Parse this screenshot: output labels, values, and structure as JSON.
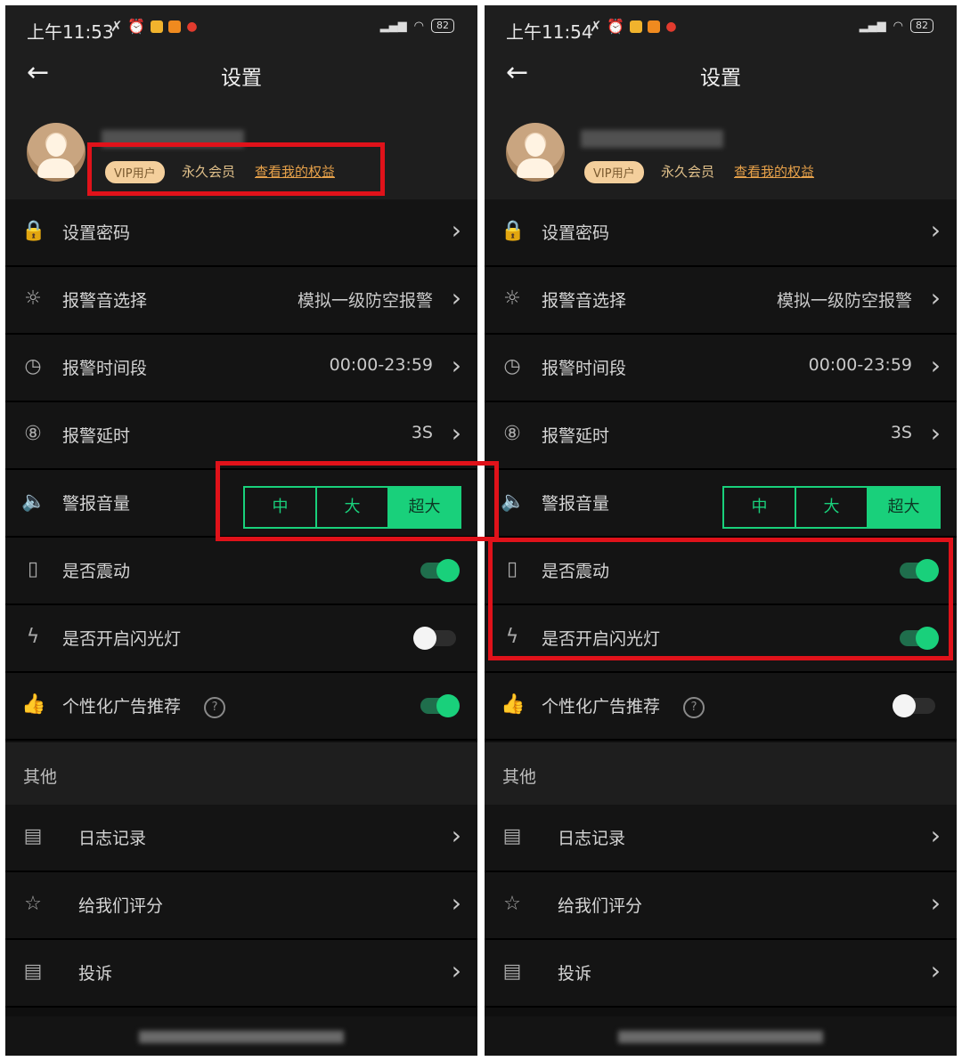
{
  "screens": [
    {
      "status": {
        "time": "上午11:53",
        "battery": "82"
      },
      "header": {
        "back_icon": "arrow-left-icon",
        "title": "设置"
      },
      "profile": {
        "vip_badge": "VIP用户",
        "member_label": "永久会员",
        "rights_link": "查看我的权益"
      },
      "settings": {
        "password": {
          "label": "设置密码"
        },
        "alarm_sound": {
          "label": "报警音选择",
          "value": "模拟一级防空报警"
        },
        "alarm_period": {
          "label": "报警时间段",
          "value": "00:00-23:59"
        },
        "alarm_delay": {
          "label": "报警延时",
          "value": "3S"
        },
        "alarm_volume": {
          "label": "警报音量",
          "options": [
            "中",
            "大",
            "超大"
          ],
          "selected": "超大"
        },
        "vibrate": {
          "label": "是否震动",
          "on": true
        },
        "flashlight": {
          "label": "是否开启闪光灯",
          "on": false
        },
        "personalized_ads": {
          "label": "个性化广告推荐",
          "help": "?",
          "on": true
        }
      },
      "other": {
        "section_label": "其他",
        "log": "日志记录",
        "rate": "给我们评分",
        "complaint": "投诉"
      }
    },
    {
      "status": {
        "time": "上午11:54",
        "battery": "82"
      },
      "header": {
        "back_icon": "arrow-left-icon",
        "title": "设置"
      },
      "profile": {
        "vip_badge": "VIP用户",
        "member_label": "永久会员",
        "rights_link": "查看我的权益"
      },
      "settings": {
        "password": {
          "label": "设置密码"
        },
        "alarm_sound": {
          "label": "报警音选择",
          "value": "模拟一级防空报警"
        },
        "alarm_period": {
          "label": "报警时间段",
          "value": "00:00-23:59"
        },
        "alarm_delay": {
          "label": "报警延时",
          "value": "3S"
        },
        "alarm_volume": {
          "label": "警报音量",
          "options": [
            "中",
            "大",
            "超大"
          ],
          "selected": "超大"
        },
        "vibrate": {
          "label": "是否震动",
          "on": true
        },
        "flashlight": {
          "label": "是否开启闪光灯",
          "on": true
        },
        "personalized_ads": {
          "label": "个性化广告推荐",
          "help": "?",
          "on": false
        }
      },
      "other": {
        "section_label": "其他",
        "log": "日志记录",
        "rate": "给我们评分",
        "complaint": "投诉"
      }
    }
  ],
  "colors": {
    "accent_green": "#19d07b",
    "highlight_red": "#e0121a",
    "vip_gold": "#f4cf9c"
  }
}
